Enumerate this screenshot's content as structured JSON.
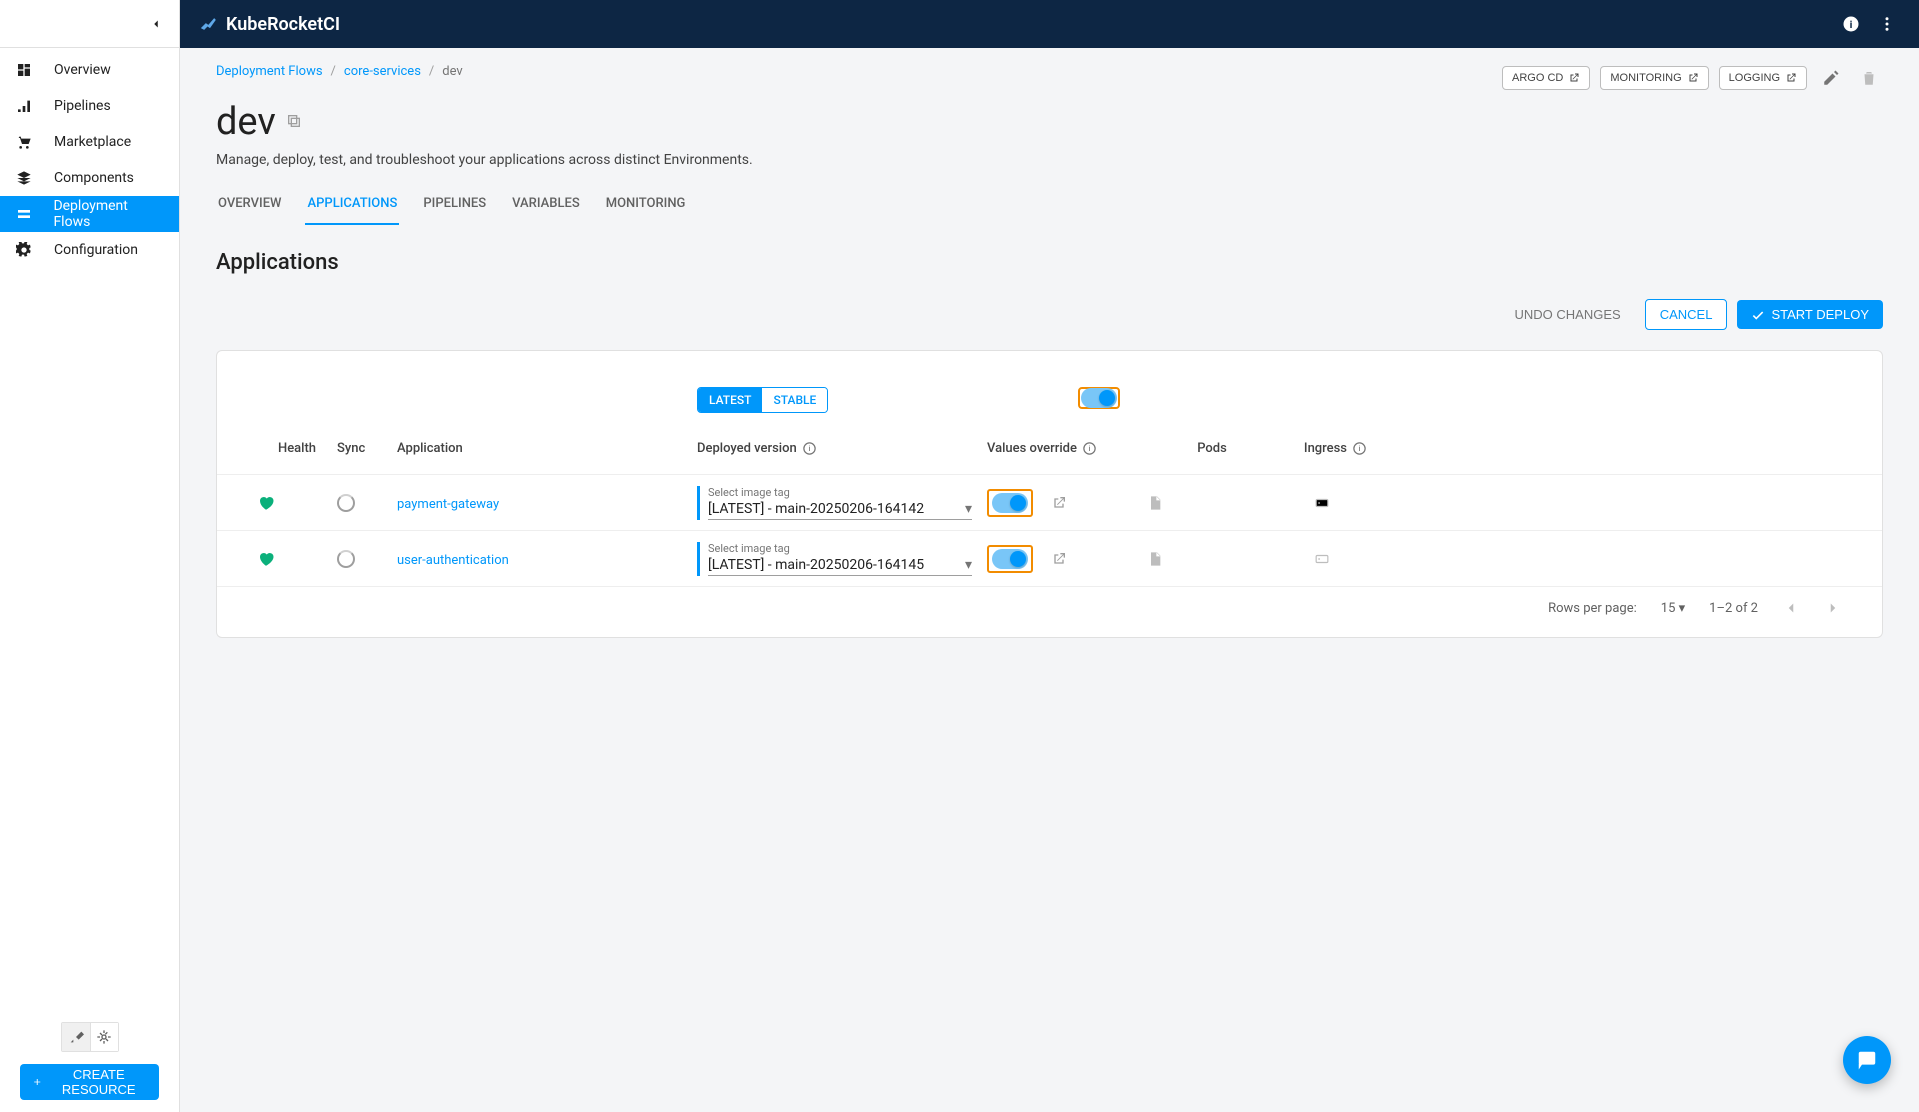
{
  "brand": "KubeRocketCI",
  "sidebar": {
    "items": [
      {
        "label": "Overview",
        "icon": "dashboard-icon"
      },
      {
        "label": "Pipelines",
        "icon": "pipelines-icon"
      },
      {
        "label": "Marketplace",
        "icon": "cart-icon"
      },
      {
        "label": "Components",
        "icon": "layers-icon"
      },
      {
        "label": "Deployment Flows",
        "icon": "deployment-icon"
      },
      {
        "label": "Configuration",
        "icon": "gear-icon"
      }
    ],
    "create_btn": "CREATE RESOURCE"
  },
  "breadcrumbs": {
    "0": "Deployment Flows",
    "1": "core-services",
    "2": "dev"
  },
  "header_actions": {
    "argocd": "ARGO CD",
    "monitoring": "MONITORING",
    "logging": "LOGGING"
  },
  "page": {
    "title": "dev",
    "desc": "Manage, deploy, test, and troubleshoot your applications across distinct Environments."
  },
  "tabs": {
    "overview": "OVERVIEW",
    "applications": "APPLICATIONS",
    "pipelines": "PIPELINES",
    "variables": "VARIABLES",
    "monitoring": "MONITORING"
  },
  "section_title": "Applications",
  "toolbar": {
    "undo": "UNDO CHANGES",
    "cancel": "CANCEL",
    "start": "START DEPLOY"
  },
  "version_toggle": {
    "latest": "LATEST",
    "stable": "STABLE"
  },
  "columns": {
    "health": "Health",
    "sync": "Sync",
    "app": "Application",
    "deployed": "Deployed version",
    "override": "Values override",
    "pods": "Pods",
    "ingress": "Ingress"
  },
  "rows": [
    {
      "app": "payment-gateway",
      "select_label": "Select image tag",
      "select_value": "[LATEST] - main-20250206-164142"
    },
    {
      "app": "user-authentication",
      "select_label": "Select image tag",
      "select_value": "[LATEST] - main-20250206-164145"
    }
  ],
  "pagination": {
    "rpp_label": "Rows per page:",
    "rpp_value": "15",
    "range": "1–2 of 2"
  }
}
